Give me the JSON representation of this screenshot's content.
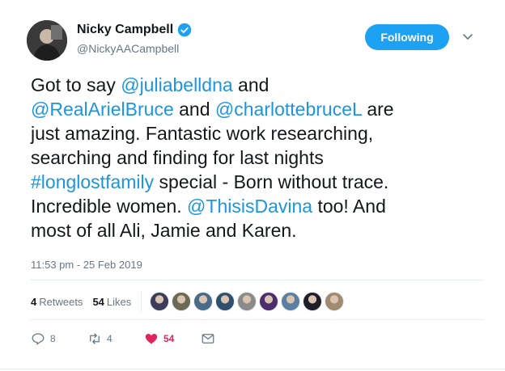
{
  "user": {
    "display_name": "Nicky Campbell",
    "handle": "@NickyAACampbell",
    "verified_icon": "verified-badge-icon",
    "follow_label": "Following",
    "accent": "#1da1f2"
  },
  "tweet": {
    "segments": [
      {
        "text": "Got to say ",
        "type": "text"
      },
      {
        "text": "@juliabelldna",
        "type": "mention"
      },
      {
        "text": " and",
        "type": "text"
      },
      {
        "text": "@RealArielBruce",
        "type": "mention"
      },
      {
        "text": " and ",
        "type": "text"
      },
      {
        "text": "@charlottebruceL",
        "type": "mention"
      },
      {
        "text": " are",
        "type": "text"
      },
      {
        "text": "just amazing. Fantastic work researching,",
        "type": "text"
      },
      {
        "text": "searching and finding for last nights",
        "type": "text"
      },
      {
        "text": "#longlostfamily",
        "type": "mention"
      },
      {
        "text": " special - Born without trace.",
        "type": "text"
      },
      {
        "text": "Incredible women. ",
        "type": "text"
      },
      {
        "text": "@ThisisDavina",
        "type": "mention"
      },
      {
        "text": " too! And",
        "type": "text"
      },
      {
        "text": "most of all Ali, Jamie and Karen.",
        "type": "text"
      }
    ],
    "mention_color": "#1b95e0",
    "timestamp": "11:53 pm - 25 Feb 2019"
  },
  "stats": {
    "retweets_count": "4",
    "retweets_label": "Retweets",
    "likes_count": "54",
    "likes_label": "Likes",
    "liker_avatars": [
      "#3b3d5a",
      "#6b6a55",
      "#4a6a8a",
      "#2e4f6e",
      "#8a8a8a",
      "#4d2d6b",
      "#5b7fa0",
      "#1e1e28",
      "#a08a70"
    ]
  },
  "actions": {
    "reply_count": "8",
    "retweet_count": "4",
    "like_count": "54",
    "like_color": "#e0245e"
  }
}
